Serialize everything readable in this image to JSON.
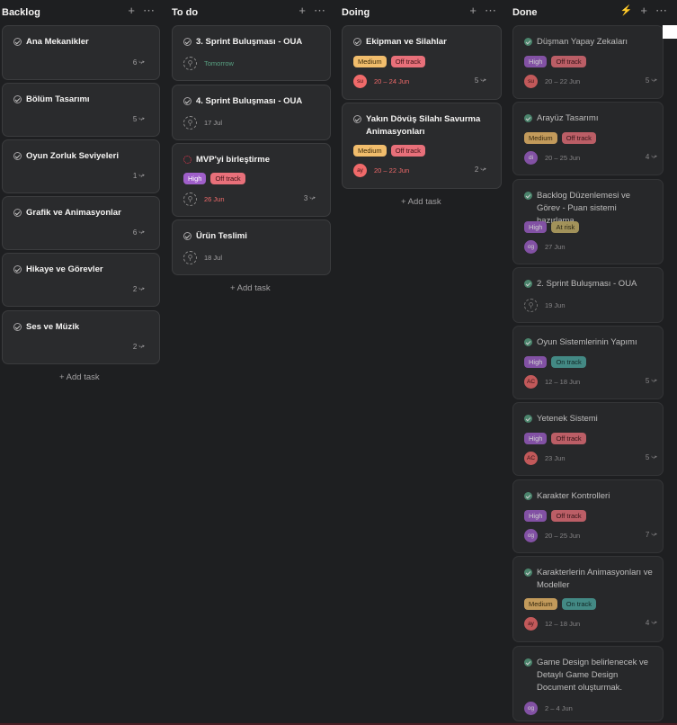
{
  "colors": {
    "background": "#1e1f21",
    "card": "#2a2b2d",
    "high": "#9f5fc9",
    "medium": "#f1bd6c",
    "off_track": "#e8707a",
    "at_risk": "#c7b36b",
    "on_track": "#4ea7a0"
  },
  "columns": [
    {
      "title": "Backlog",
      "add_task": "+ Add task",
      "cards": [
        {
          "title": "Ana Mekanikler",
          "subtasks": "6"
        },
        {
          "title": "Bölüm Tasarımı",
          "subtasks": "5"
        },
        {
          "title": "Oyun Zorluk Seviyeleri",
          "subtasks": "1"
        },
        {
          "title": "Grafik ve Animasyonlar",
          "subtasks": "6"
        },
        {
          "title": "Hikaye ve Görevler",
          "subtasks": "2"
        },
        {
          "title": "Ses ve Müzik",
          "subtasks": "2"
        }
      ]
    },
    {
      "title": "To do",
      "add_task": "+ Add task",
      "cards": [
        {
          "title": "3. Sprint Buluşması - OUA",
          "date": "Tomorrow"
        },
        {
          "title": "4. Sprint Buluşması - OUA",
          "date": "17 Jul"
        },
        {
          "title": "MVP'yi birleştirme",
          "tags": [
            "High",
            "Off track"
          ],
          "date": "26 Jun",
          "subtasks": "3"
        },
        {
          "title": "Ürün Teslimi",
          "date": "18 Jul"
        }
      ]
    },
    {
      "title": "Doing",
      "add_task": "+ Add task",
      "cards": [
        {
          "title": "Ekipman ve Silahlar",
          "tags": [
            "Medium",
            "Off track"
          ],
          "avatar": "su",
          "date": "20 – 24 Jun",
          "subtasks": "5"
        },
        {
          "title": "Yakın Dövüş Silahı Savurma Animasyonları",
          "tags": [
            "Medium",
            "Off track"
          ],
          "avatar": "ay",
          "date": "20 – 22 Jun",
          "subtasks": "2"
        }
      ]
    },
    {
      "title": "Done",
      "cards": [
        {
          "title": "Düşman Yapay Zekaları",
          "tags": [
            "High",
            "Off track"
          ],
          "avatar": "su",
          "date": "20 – 22 Jun",
          "subtasks": "5"
        },
        {
          "title": "Arayüz Tasarımı",
          "tags": [
            "Medium",
            "Off track"
          ],
          "avatar": "di",
          "date": "20 – 25 Jun",
          "subtasks": "4"
        },
        {
          "title": "Backlog Düzenlemesi ve Görev - Puan sistemi hazırlama",
          "tags": [
            "High",
            "At risk"
          ],
          "avatar": "og",
          "date": "27 Jun"
        },
        {
          "title": "2. Sprint Buluşması - OUA",
          "date": "19 Jun"
        },
        {
          "title": "Oyun Sistemlerinin Yapımı",
          "tags": [
            "High",
            "On track"
          ],
          "avatar": "AC",
          "date": "12 – 18 Jun",
          "subtasks": "5"
        },
        {
          "title": "Yetenek Sistemi",
          "tags": [
            "High",
            "Off track"
          ],
          "avatar": "AC",
          "date": "23 Jun",
          "subtasks": "5"
        },
        {
          "title": "Karakter Kontrolleri",
          "tags": [
            "High",
            "Off track"
          ],
          "avatar": "og",
          "date": "20 – 25 Jun",
          "subtasks": "7"
        },
        {
          "title": "Karakterlerin Animasyonları ve Modeller",
          "tags": [
            "Medium",
            "On track"
          ],
          "avatar": "ay",
          "date": "12 – 18 Jun",
          "subtasks": "4"
        },
        {
          "title": "Game Design belirlenecek ve Detaylı Game Design Document oluşturmak.",
          "avatar": "og",
          "date": "2 – 4 Jun"
        }
      ]
    }
  ]
}
